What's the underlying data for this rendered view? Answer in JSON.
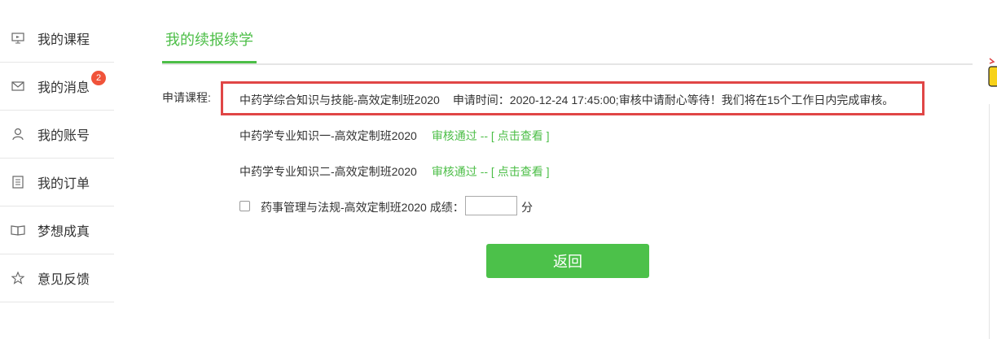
{
  "sidebar": {
    "items": [
      {
        "label": "我的课程",
        "icon": "monitor-icon"
      },
      {
        "label": "我的消息",
        "icon": "envelope-icon",
        "badge": "2"
      },
      {
        "label": "我的账号",
        "icon": "user-icon"
      },
      {
        "label": "我的订单",
        "icon": "document-icon"
      },
      {
        "label": "梦想成真",
        "icon": "book-icon"
      },
      {
        "label": "意见反馈",
        "icon": "star-icon"
      }
    ]
  },
  "main": {
    "tab_active": "我的续报续学",
    "apply_label": "申请课程:",
    "highlighted": {
      "course": "中药学综合知识与技能-高效定制班2020",
      "time_text": "申请时间：2020-12-24 17:45:00;审核中请耐心等待！我们将在15个工作日内完成审核。"
    },
    "courses": [
      {
        "name": "中药学专业知识一-高效定制班2020",
        "status": "审核通过 --",
        "link": "[ 点击查看 ]"
      },
      {
        "name": "中药学专业知识二-高效定制班2020",
        "status": "审核通过 --",
        "link": "[ 点击查看 ]"
      }
    ],
    "score_row": {
      "label": "药事管理与法规-高效定制班2020 成绩：",
      "value": "",
      "unit": "分"
    },
    "back_button": "返回"
  },
  "colors": {
    "accent": "#4cbe47",
    "highlight": "#e04646",
    "badge": "#f0533a"
  }
}
